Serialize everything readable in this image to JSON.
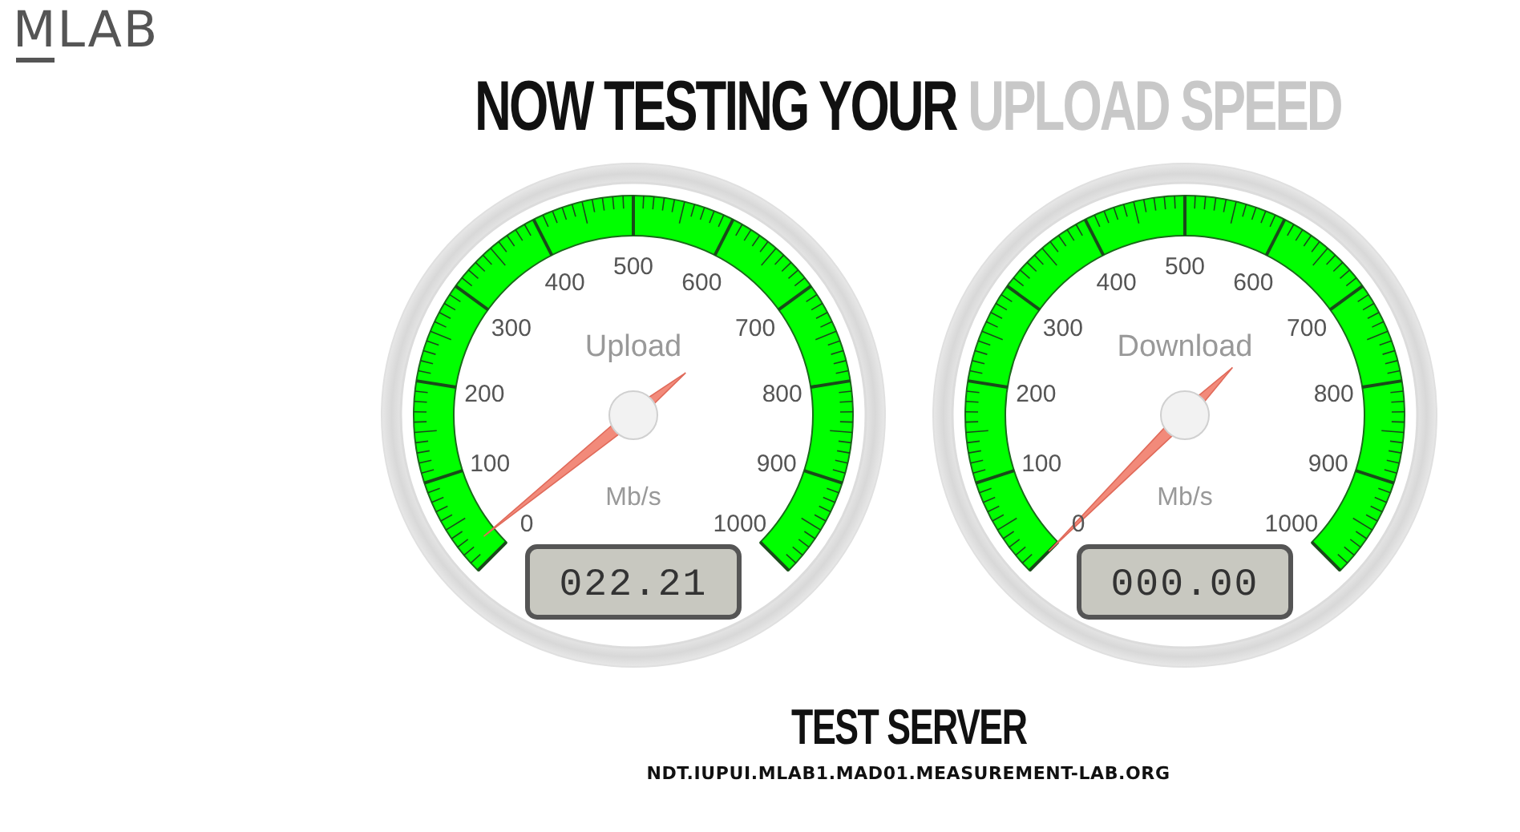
{
  "logo": "MLAB",
  "heading": {
    "text": "NOW TESTING YOUR ",
    "highlight": "UPLOAD SPEED"
  },
  "gauges": [
    {
      "label": "Upload",
      "unit": "Mb/s",
      "ticks": [
        "0",
        "100",
        "200",
        "300",
        "400",
        "500",
        "600",
        "700",
        "800",
        "900",
        "1000"
      ],
      "readout": "022.21"
    },
    {
      "label": "Download",
      "unit": "Mb/s",
      "ticks": [
        "0",
        "100",
        "200",
        "300",
        "400",
        "500",
        "600",
        "700",
        "800",
        "900",
        "1000"
      ],
      "readout": "000.00"
    }
  ],
  "server": {
    "heading": "TEST SERVER",
    "host": "NDT.IUPUI.MLAB1.MAD01.MEASUREMENT-LAB.ORG"
  }
}
